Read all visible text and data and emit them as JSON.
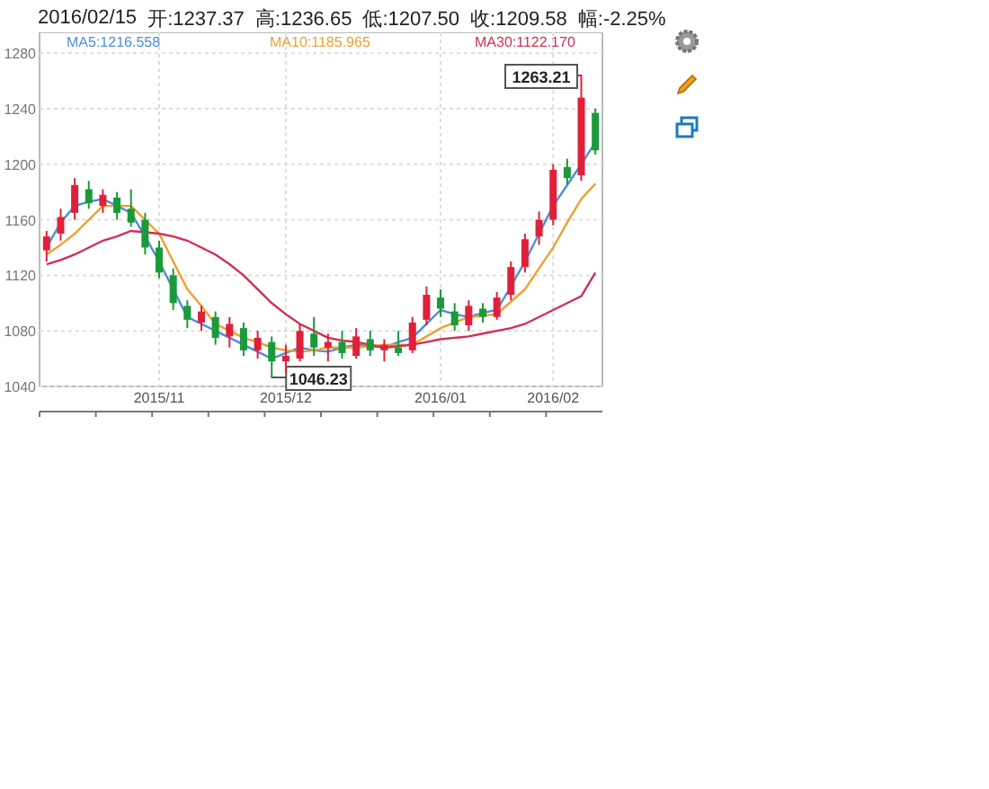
{
  "header": {
    "date": "2016/02/15",
    "items": [
      {
        "label": "开:",
        "value": "1237.37"
      },
      {
        "label": "高:",
        "value": "1236.65"
      },
      {
        "label": "低:",
        "value": "1207.50"
      },
      {
        "label": "收:",
        "value": "1209.58"
      },
      {
        "label": "幅:",
        "value": "-2.25%"
      }
    ]
  },
  "chart": {
    "ma_readings": [
      ":1216.558",
      ":1185.965",
      ":1122.170"
    ],
    "high_tag": "1263.21",
    "low_tag": "1046.23",
    "chart_data": {
      "type": "candlestick",
      "grid": true,
      "ylim": [
        1040,
        1295
      ],
      "categories": [
        null,
        null,
        null,
        null,
        null,
        null,
        null,
        null,
        "2015/11",
        null,
        null,
        null,
        null,
        null,
        null,
        null,
        null,
        "2015/12",
        null,
        null,
        null,
        null,
        null,
        null,
        null,
        null,
        null,
        null,
        "2016/01",
        null,
        null,
        null,
        null,
        null,
        null,
        null,
        "2016/02",
        null,
        null,
        null
      ],
      "yticks": [
        1040,
        1080,
        1120,
        1160,
        1200,
        1240,
        1280
      ],
      "ohlc": [
        [
          1138,
          1152,
          1130,
          1148
        ],
        [
          1150,
          1168,
          1145,
          1162
        ],
        [
          1165,
          1190,
          1160,
          1185
        ],
        [
          1182,
          1188,
          1168,
          1172
        ],
        [
          1170,
          1182,
          1165,
          1178
        ],
        [
          1176,
          1180,
          1160,
          1165
        ],
        [
          1168,
          1182,
          1155,
          1158
        ],
        [
          1160,
          1165,
          1135,
          1140
        ],
        [
          1140,
          1145,
          1118,
          1122
        ],
        [
          1120,
          1125,
          1095,
          1100
        ],
        [
          1098,
          1102,
          1082,
          1088
        ],
        [
          1086,
          1098,
          1080,
          1094
        ],
        [
          1090,
          1094,
          1070,
          1075
        ],
        [
          1076,
          1090,
          1068,
          1085
        ],
        [
          1082,
          1086,
          1062,
          1066
        ],
        [
          1066,
          1080,
          1060,
          1075
        ],
        [
          1072,
          1076,
          1046,
          1058
        ],
        [
          1058,
          1070,
          1050,
          1062
        ],
        [
          1060,
          1085,
          1058,
          1080
        ],
        [
          1078,
          1090,
          1062,
          1068
        ],
        [
          1068,
          1078,
          1058,
          1072
        ],
        [
          1072,
          1080,
          1060,
          1064
        ],
        [
          1062,
          1082,
          1060,
          1076
        ],
        [
          1074,
          1080,
          1062,
          1066
        ],
        [
          1066,
          1074,
          1058,
          1070
        ],
        [
          1068,
          1080,
          1062,
          1064
        ],
        [
          1066,
          1090,
          1064,
          1086
        ],
        [
          1088,
          1112,
          1084,
          1106
        ],
        [
          1104,
          1110,
          1090,
          1096
        ],
        [
          1094,
          1100,
          1080,
          1084
        ],
        [
          1084,
          1102,
          1080,
          1098
        ],
        [
          1096,
          1100,
          1086,
          1090
        ],
        [
          1090,
          1108,
          1088,
          1104
        ],
        [
          1106,
          1130,
          1102,
          1126
        ],
        [
          1126,
          1150,
          1122,
          1146
        ],
        [
          1148,
          1166,
          1142,
          1160
        ],
        [
          1160,
          1200,
          1156,
          1196
        ],
        [
          1198,
          1204,
          1185,
          1190
        ],
        [
          1192,
          1263,
          1188,
          1248
        ],
        [
          1237,
          1240,
          1207,
          1210
        ]
      ],
      "series": [
        {
          "name": "MA5",
          "type": "line",
          "color": "#4a8fd8",
          "values": [
            1140,
            1158,
            1170,
            1173,
            1175,
            1170,
            1165,
            1148,
            1130,
            1110,
            1090,
            1085,
            1080,
            1075,
            1070,
            1065,
            1060,
            1064,
            1068,
            1066,
            1065,
            1068,
            1070,
            1069,
            1068,
            1072,
            1075,
            1085,
            1095,
            1092,
            1090,
            1093,
            1095,
            1112,
            1130,
            1150,
            1170,
            1185,
            1200,
            1216
          ]
        },
        {
          "name": "MA10",
          "type": "line",
          "color": "#f0a030",
          "values": [
            1135,
            1142,
            1150,
            1160,
            1170,
            1170,
            1170,
            1160,
            1150,
            1130,
            1110,
            1098,
            1085,
            1080,
            1075,
            1072,
            1068,
            1066,
            1065,
            1066,
            1068,
            1068,
            1068,
            1069,
            1070,
            1070,
            1070,
            1076,
            1082,
            1086,
            1090,
            1091,
            1092,
            1101,
            1110,
            1125,
            1140,
            1158,
            1175,
            1186
          ]
        },
        {
          "name": "MA30",
          "type": "line",
          "color": "#d03050",
          "values": [
            1128,
            1131,
            1135,
            1140,
            1145,
            1148,
            1152,
            1151,
            1150,
            1148,
            1145,
            1140,
            1135,
            1128,
            1120,
            1110,
            1100,
            1092,
            1085,
            1080,
            1075,
            1073,
            1072,
            1070,
            1068,
            1069,
            1070,
            1072,
            1074,
            1075,
            1076,
            1078,
            1080,
            1082,
            1085,
            1090,
            1095,
            1100,
            1105,
            1122
          ]
        }
      ]
    }
  }
}
